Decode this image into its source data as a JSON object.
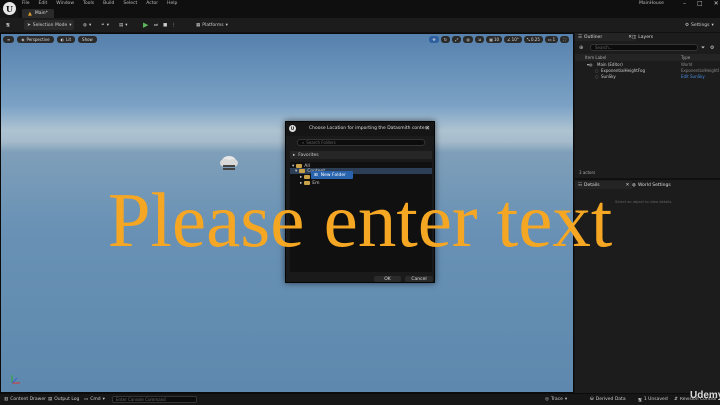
{
  "menubar": {
    "logo": "U",
    "items": [
      "File",
      "Edit",
      "Window",
      "Tools",
      "Build",
      "Select",
      "Actor",
      "Help"
    ],
    "project": "MainHouse",
    "minimize": "–",
    "maximize": "□",
    "close": "✕"
  },
  "map_tab": {
    "label": "Main*",
    "icon": "map-icon"
  },
  "toolbar": {
    "save_icon": "save-icon",
    "mode": "Selection Mode",
    "platforms": "Platforms",
    "settings": "Settings"
  },
  "viewport": {
    "perspective": "Perspective",
    "lit": "Lit",
    "show": "Show",
    "grid_size": "10",
    "angle": "10°",
    "scale": "0.25",
    "camera_speed": "1"
  },
  "overlay_text": "Please enter text",
  "dialog": {
    "logo": "U",
    "title": "Choose Location for importing the Datasmith content",
    "search_placeholder": "Search Folders",
    "favorites": "Favorites",
    "tree_all": "All",
    "tree_content": "Content",
    "tree_child1": "Ma",
    "tree_child2": "Em",
    "context_menu": "New Folder",
    "ok": "OK",
    "cancel": "Cancel",
    "close": "✕"
  },
  "outliner": {
    "tab": "Outliner",
    "layers_tab": "Layers",
    "search_placeholder": "Search...",
    "col_label": "Item Label",
    "col_type": "Type",
    "rows": [
      {
        "label": "Main (Editor)",
        "type": "World"
      },
      {
        "label": "ExponentialHeightFog",
        "type": "ExponentialHeightFog"
      },
      {
        "label": "SunSky",
        "type": "Edit SunSky"
      }
    ],
    "actor_count": "3 actors"
  },
  "details": {
    "tab": "Details",
    "world_settings_tab": "World Settings",
    "hint": "Select an object to view details."
  },
  "bottombar": {
    "content_drawer": "Content Drawer",
    "output_log": "Output Log",
    "cmd": "Cmd",
    "cmd_placeholder": "Enter Console Command",
    "trace": "Trace",
    "derived_data": "Derived Data",
    "unsaved": "1 Unsaved",
    "revision": "Revision Control"
  },
  "watermark": "Udemy",
  "colors": {
    "accent_blue": "#2962ad",
    "overlay_orange": "#f5a623",
    "play_green": "#5cb85c"
  }
}
